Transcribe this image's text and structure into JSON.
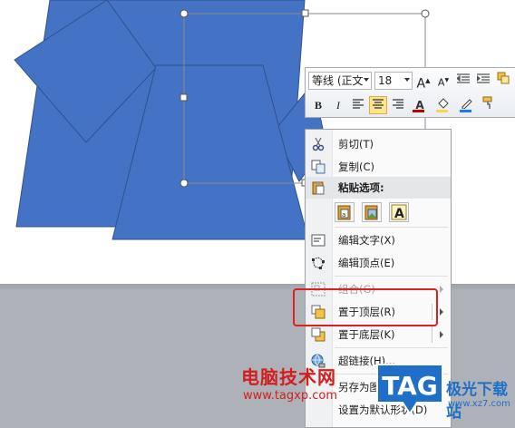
{
  "toolbar": {
    "font_name": "等线 (正文",
    "font_size": "18",
    "grow_font": "A",
    "shrink_font": "A",
    "bold": "B",
    "italic": "I",
    "font_color_letter": "A",
    "font_color": "#c00000",
    "fill_color": "#ffd34d",
    "outline_color": "#1f77ff"
  },
  "context_menu": {
    "cut": "剪切(T)",
    "copy": "复制(C)",
    "paste_options_header": "粘贴选项:",
    "edit_text": "编辑文字(X)",
    "edit_points": "编辑顶点(E)",
    "group": "组合(G)",
    "bring_to_front": "置于顶层(R)",
    "send_to_back": "置于底层(K)",
    "hyperlink": "超链接(H)...",
    "save_as_picture": "另存为图片(S)...",
    "set_default_shape": "设置为默认形状(D)"
  },
  "watermarks": {
    "site_name": "电脑技术网",
    "site_url": "www.tagxp.com",
    "tag_logo": "TAG",
    "download_site": "极光下载站",
    "download_url": "www.xz7.com"
  },
  "colors": {
    "shape_fill": "#4472c4",
    "shape_stroke": "#2f528f",
    "highlight": "#e02020"
  }
}
